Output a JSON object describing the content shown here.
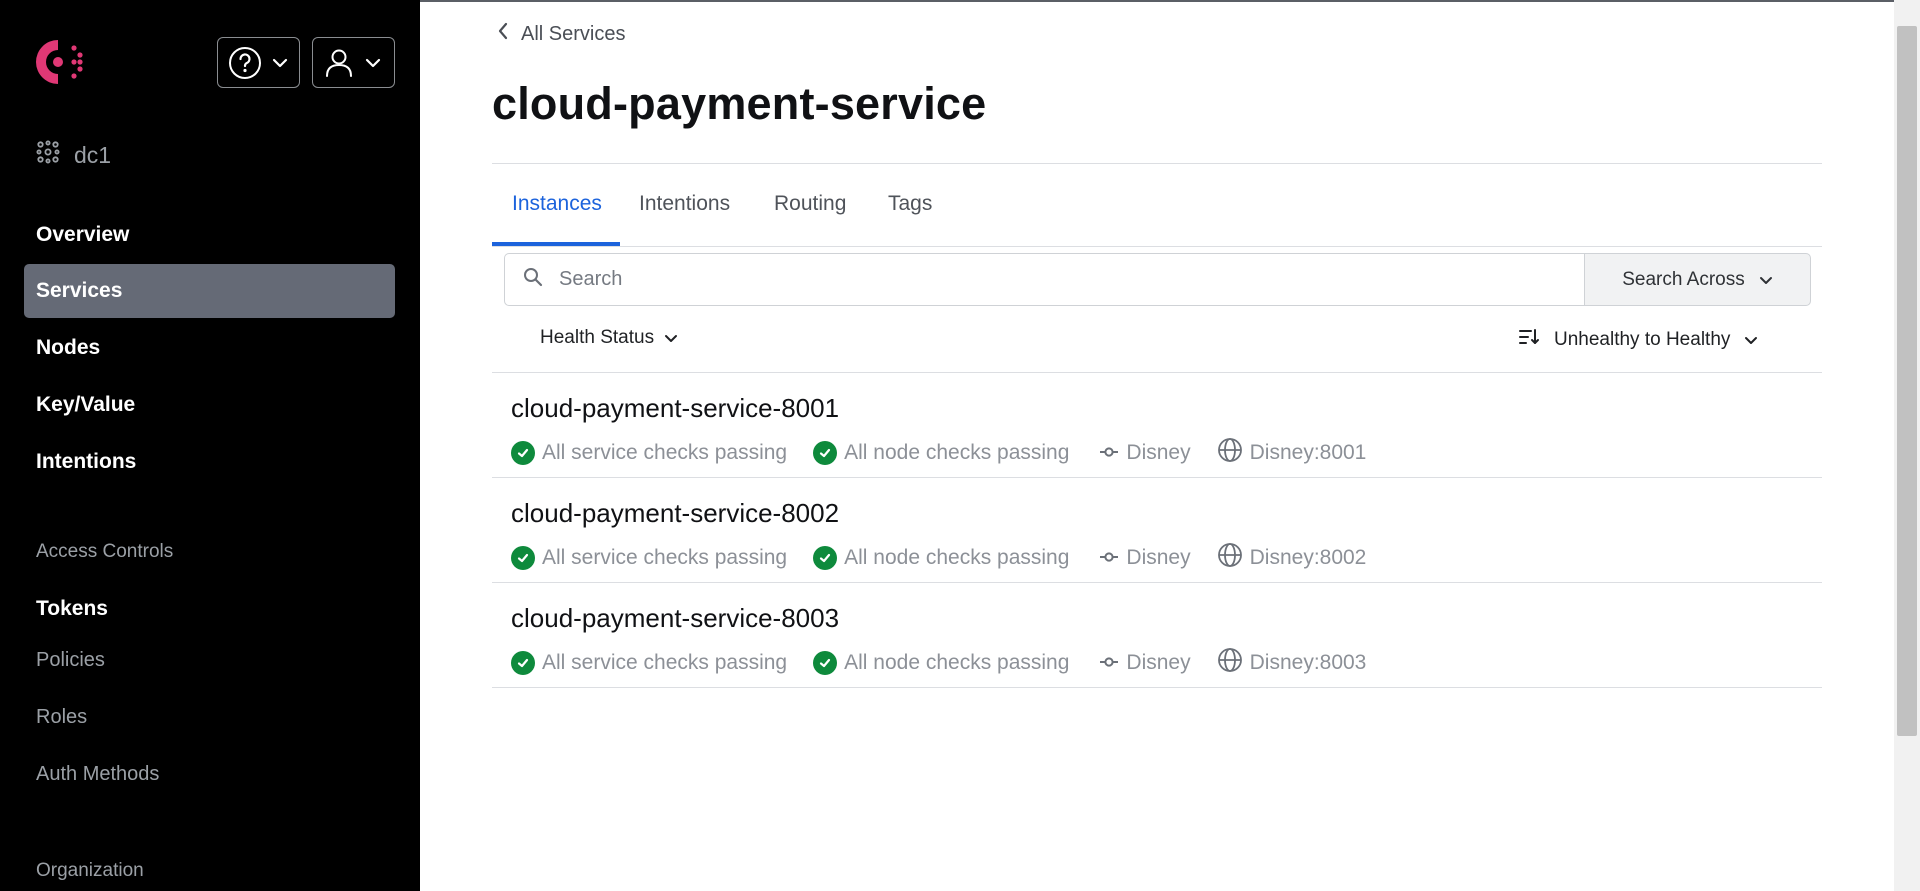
{
  "colors": {
    "sidebar_bg": "#000000",
    "active_nav_bg": "#656a76",
    "tab_active": "#1c63dc",
    "passing_green": "#0e8a3c",
    "brand_logo": "#e03875"
  },
  "sidebar": {
    "logo_icon": "consul-logo",
    "help_icon": "help-circle-icon",
    "user_icon": "user-icon",
    "datacenter": "dc1",
    "nav": [
      {
        "label": "Overview"
      },
      {
        "label": "Services",
        "active": true
      },
      {
        "label": "Nodes"
      },
      {
        "label": "Key/Value"
      },
      {
        "label": "Intentions"
      }
    ],
    "access_controls_heading": "Access Controls",
    "access_items": [
      {
        "label": "Tokens"
      },
      {
        "label": "Policies"
      },
      {
        "label": "Roles"
      },
      {
        "label": "Auth Methods"
      }
    ],
    "organization_heading": "Organization"
  },
  "main": {
    "back_label": "All Services",
    "title": "cloud-payment-service",
    "tabs": [
      {
        "label": "Instances",
        "active": true
      },
      {
        "label": "Intentions"
      },
      {
        "label": "Routing"
      },
      {
        "label": "Tags"
      }
    ],
    "search": {
      "placeholder": "Search",
      "across_label": "Search Across"
    },
    "filter_health": "Health Status",
    "sort_label": "Unhealthy to Healthy",
    "instances": [
      {
        "name": "cloud-payment-service-8001",
        "service_checks": "All service checks passing",
        "node_checks": "All node checks passing",
        "node": "Disney",
        "address": "Disney:8001"
      },
      {
        "name": "cloud-payment-service-8002",
        "service_checks": "All service checks passing",
        "node_checks": "All node checks passing",
        "node": "Disney",
        "address": "Disney:8002"
      },
      {
        "name": "cloud-payment-service-8003",
        "service_checks": "All service checks passing",
        "node_checks": "All node checks passing",
        "node": "Disney",
        "address": "Disney:8003"
      }
    ]
  }
}
